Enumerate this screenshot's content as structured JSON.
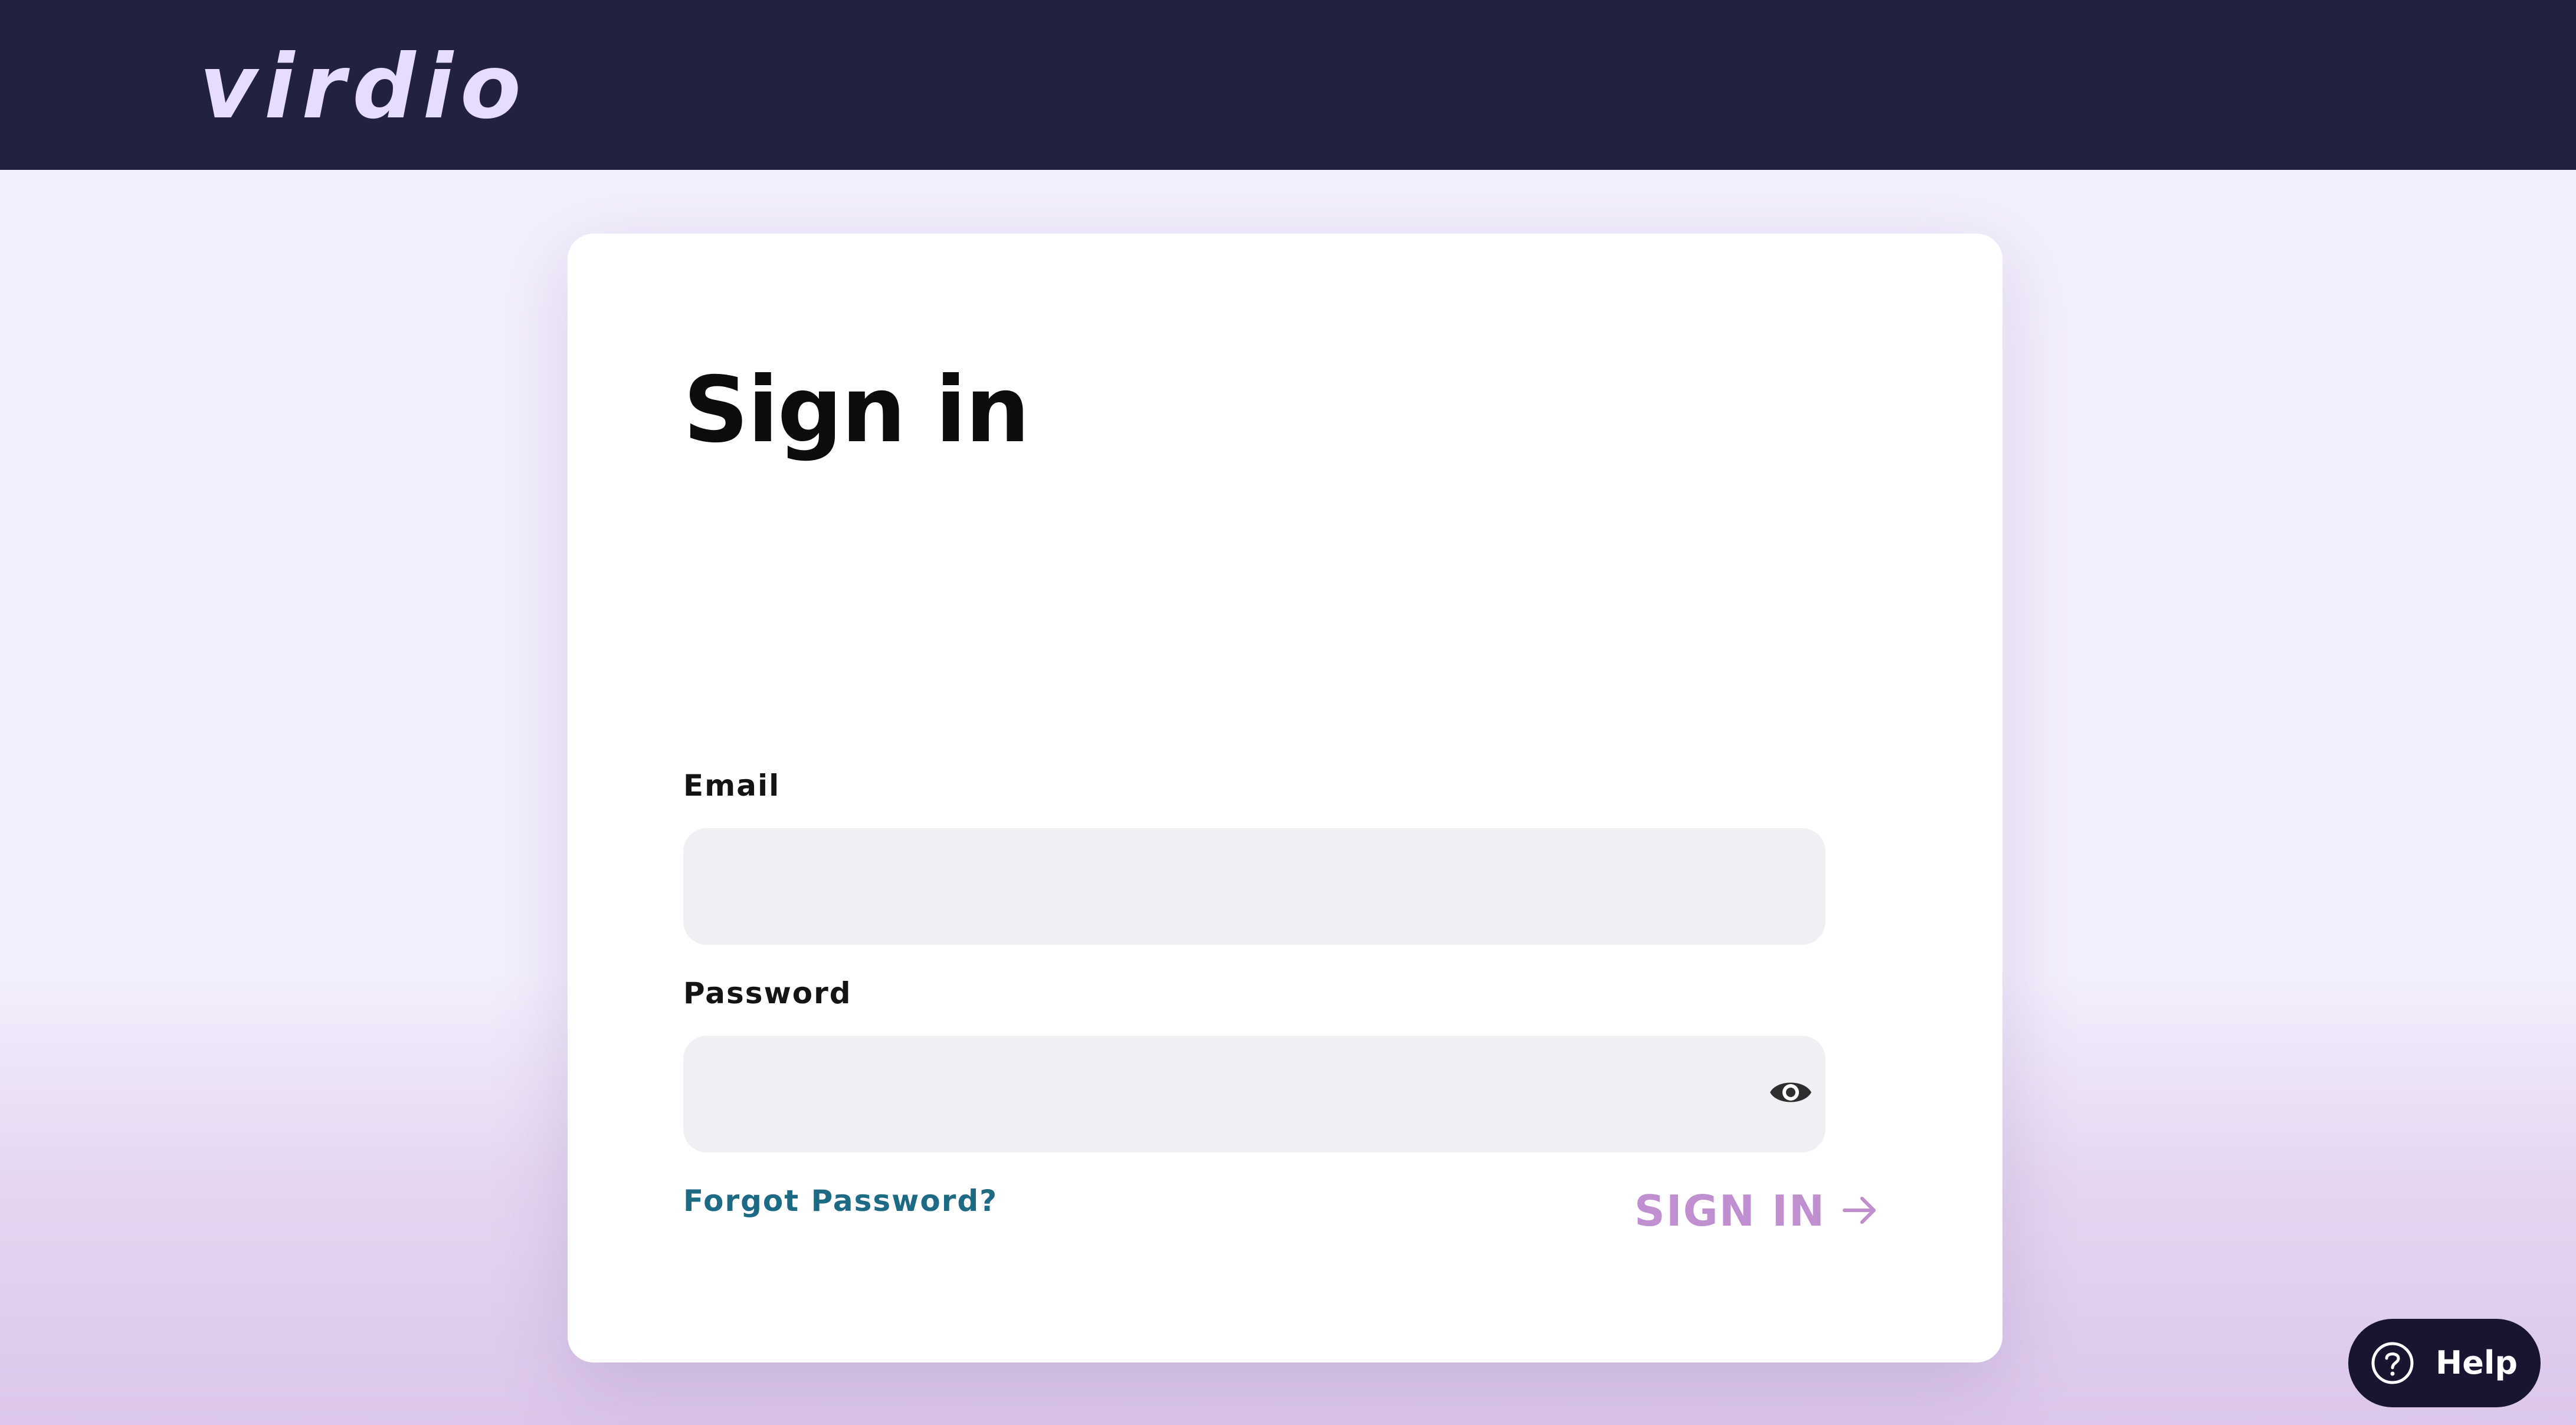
{
  "header": {
    "logo_text": "virdio",
    "background": "#232140",
    "logo_color": "#e6dcff"
  },
  "form": {
    "title": "Sign in",
    "email": {
      "label": "Email",
      "value": "",
      "placeholder": ""
    },
    "password": {
      "label": "Password",
      "value": "",
      "placeholder": "",
      "toggle_icon": "eye-icon"
    },
    "forgot_password_link": "Forgot Password?",
    "submit": {
      "label": "SIGN IN",
      "icon": "arrow-right-icon",
      "color": "#bf8fd0"
    }
  },
  "help": {
    "label": "Help",
    "icon": "question-circle-icon",
    "background": "#171530"
  },
  "colors": {
    "link": "#1d6a84",
    "field_background": "#eff0f4",
    "page_background": "#f3effd"
  }
}
